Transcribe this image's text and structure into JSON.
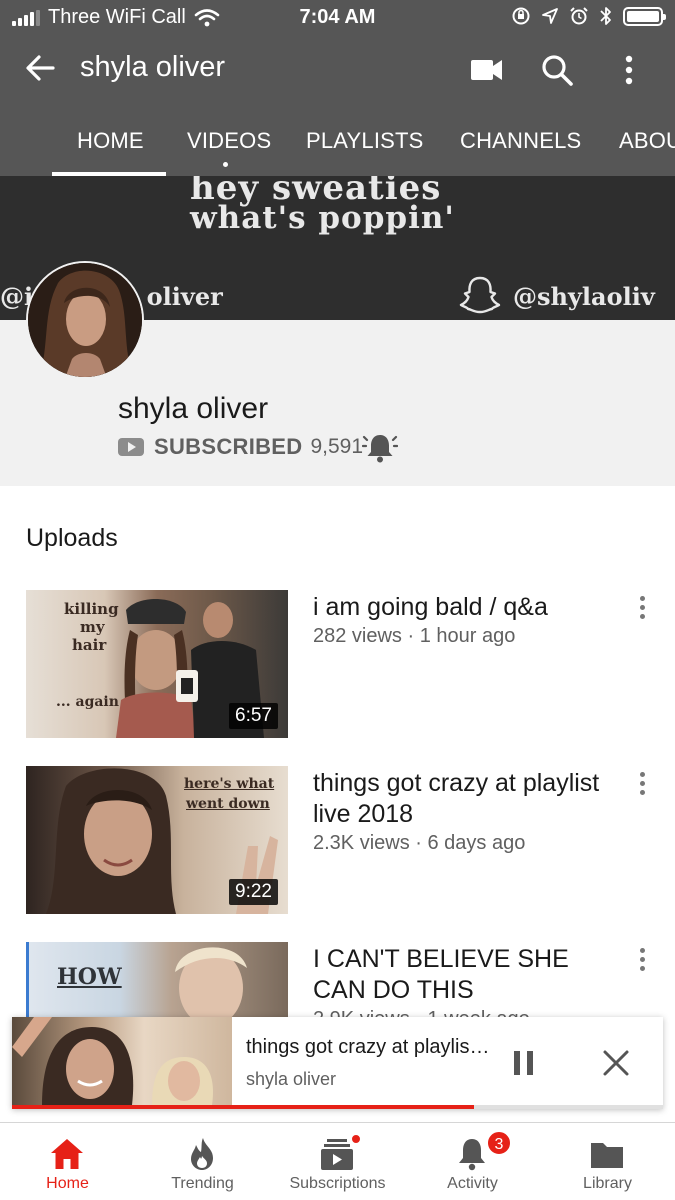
{
  "status_bar": {
    "carrier": "Three WiFi Call",
    "time": "7:04 AM"
  },
  "app_bar": {
    "title": "shyla oliver"
  },
  "tabs": [
    {
      "label": "HOME",
      "active": true
    },
    {
      "label": "VIDEOS"
    },
    {
      "label": "PLAYLISTS"
    },
    {
      "label": "CHANNELS"
    },
    {
      "label": "ABOU"
    }
  ],
  "banner": {
    "line1": "hey sweaties",
    "line2": "what's poppin'",
    "left_handle": "@ia",
    "left_handle_tail": "oliver",
    "right_handle": "@shylaoliv"
  },
  "channel": {
    "name": "shyla oliver",
    "subscribed_label": "SUBSCRIBED",
    "subscriber_count": "9,591"
  },
  "uploads": {
    "heading": "Uploads",
    "videos": [
      {
        "title": "i am going bald / q&a",
        "meta": "282 views · 1 hour ago",
        "duration": "6:57",
        "thumb_text": [
          "killing",
          "my",
          "hair",
          "... again"
        ]
      },
      {
        "title": "things got crazy at playlist live 2018",
        "meta": "2.3K views · 6 days ago",
        "duration": "9:22",
        "thumb_text": [
          "here's what",
          "went down"
        ]
      },
      {
        "title": "I CAN'T BELIEVE SHE CAN DO THIS",
        "meta": "2.9K views · 1 week ago",
        "duration": "",
        "thumb_text": [
          "HOW"
        ]
      }
    ]
  },
  "miniplayer": {
    "title": "things got crazy at playlis…",
    "channel": "shyla oliver",
    "progress": 0.71
  },
  "bottom_nav": [
    {
      "label": "Home",
      "icon": "home-icon",
      "active": true
    },
    {
      "label": "Trending",
      "icon": "flame-icon"
    },
    {
      "label": "Subscriptions",
      "icon": "subscriptions-icon"
    },
    {
      "label": "Activity",
      "icon": "bell-icon",
      "badge": "3"
    },
    {
      "label": "Library",
      "icon": "folder-icon"
    }
  ],
  "colors": {
    "header": "#565656",
    "accent": "#e62117",
    "secondary_text": "#606060"
  }
}
